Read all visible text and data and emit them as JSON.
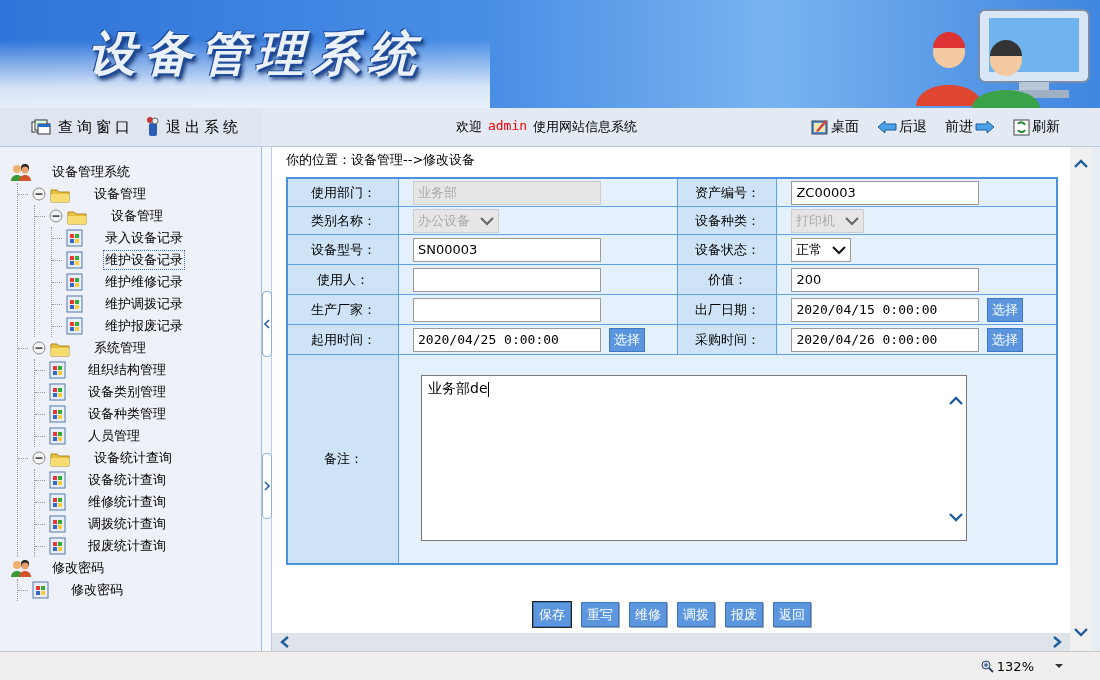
{
  "header": {
    "title": "设备管理系统"
  },
  "toolbar": {
    "left_items": [
      {
        "label": "查询窗口",
        "kind": "windows"
      },
      {
        "label": "退出系统",
        "kind": "exit"
      }
    ],
    "welcome": {
      "prefix": "欢迎",
      "user": "admin",
      "suffix": "使用网站信息系统"
    },
    "nav_items": [
      {
        "label": "桌面",
        "kind": "desktop"
      },
      {
        "label": "后退",
        "kind": "back"
      },
      {
        "label": "前进",
        "kind": "forward"
      },
      {
        "label": "刷新",
        "kind": "refresh"
      }
    ]
  },
  "tree": [
    {
      "label": "设备管理系统",
      "kind": "group",
      "selected": false,
      "children": [
        {
          "label": "设备管理",
          "kind": "folder",
          "expanded": true,
          "selected": false,
          "children": [
            {
              "label": "设备管理",
              "kind": "folder",
              "expanded": true,
              "selected": false,
              "children": [
                {
                  "label": "录入设备记录",
                  "kind": "page",
                  "selected": false
                },
                {
                  "label": "维护设备记录",
                  "kind": "page",
                  "selected": true
                },
                {
                  "label": "维护维修记录",
                  "kind": "page",
                  "selected": false
                },
                {
                  "label": "维护调拨记录",
                  "kind": "page",
                  "selected": false
                },
                {
                  "label": "维护报废记录",
                  "kind": "page",
                  "selected": false
                }
              ]
            }
          ]
        },
        {
          "label": "系统管理",
          "kind": "folder",
          "expanded": true,
          "selected": false,
          "children": [
            {
              "label": "组织结构管理",
              "kind": "page",
              "selected": false
            },
            {
              "label": "设备类别管理",
              "kind": "page",
              "selected": false
            },
            {
              "label": "设备种类管理",
              "kind": "page",
              "selected": false
            },
            {
              "label": "人员管理",
              "kind": "page",
              "selected": false
            }
          ]
        },
        {
          "label": "设备统计查询",
          "kind": "folder",
          "expanded": true,
          "selected": false,
          "children": [
            {
              "label": "设备统计查询",
              "kind": "page",
              "selected": false
            },
            {
              "label": "维修统计查询",
              "kind": "page",
              "selected": false
            },
            {
              "label": "调拨统计查询",
              "kind": "page",
              "selected": false
            },
            {
              "label": "报废统计查询",
              "kind": "page",
              "selected": false
            }
          ]
        }
      ]
    },
    {
      "label": "修改密码",
      "kind": "group",
      "selected": false,
      "children": [
        {
          "label": "修改密码",
          "kind": "page",
          "selected": false
        }
      ]
    }
  ],
  "breadcrumb": "你的位置：设备管理-->修改设备",
  "form": {
    "rows": [
      [
        {
          "label": "使用部门：",
          "field": {
            "kind": "text",
            "value": "业务部",
            "disabled": true
          }
        },
        {
          "label": "资产编号：",
          "field": {
            "kind": "text",
            "value": "ZC00003",
            "disabled": false
          }
        }
      ],
      [
        {
          "label": "类别名称：",
          "field": {
            "kind": "select",
            "value": "办公设备",
            "disabled": true
          }
        },
        {
          "label": "设备种类：",
          "field": {
            "kind": "select",
            "value": "打印机",
            "disabled": true
          }
        }
      ],
      [
        {
          "label": "设备型号：",
          "field": {
            "kind": "text",
            "value": "SN00003",
            "disabled": false
          }
        },
        {
          "label": "设备状态：",
          "field": {
            "kind": "select",
            "value": "正常",
            "disabled": false
          }
        }
      ],
      [
        {
          "label": "使用人：",
          "field": {
            "kind": "text",
            "disabled": false
          }
        },
        {
          "label": "价值：",
          "field": {
            "kind": "text",
            "value": "200",
            "disabled": false
          }
        }
      ],
      [
        {
          "label": "生产厂家：",
          "field": {
            "kind": "text",
            "disabled": false
          }
        },
        {
          "label": "出厂日期：",
          "field": {
            "kind": "date",
            "value": "2020/04/15 0:00:00",
            "button": "选择",
            "disabled": false
          }
        }
      ],
      [
        {
          "label": "起用时间：",
          "field": {
            "kind": "date",
            "value": "2020/04/25 0:00:00",
            "button": "选择",
            "disabled": false
          }
        },
        {
          "label": "采购时间：",
          "field": {
            "kind": "date",
            "value": "2020/04/26 0:00:00",
            "button": "选择",
            "disabled": false
          }
        }
      ]
    ],
    "notes": {
      "label": "备注：",
      "value": "业务部de"
    }
  },
  "buttons": [
    {
      "label": "保存",
      "focused": true
    },
    {
      "label": "重写",
      "focused": false
    },
    {
      "label": "维修",
      "focused": false
    },
    {
      "label": "调拨",
      "focused": false
    },
    {
      "label": "报废",
      "focused": false
    },
    {
      "label": "返回",
      "focused": false
    }
  ],
  "status_bar": {
    "zoom": "132%"
  }
}
